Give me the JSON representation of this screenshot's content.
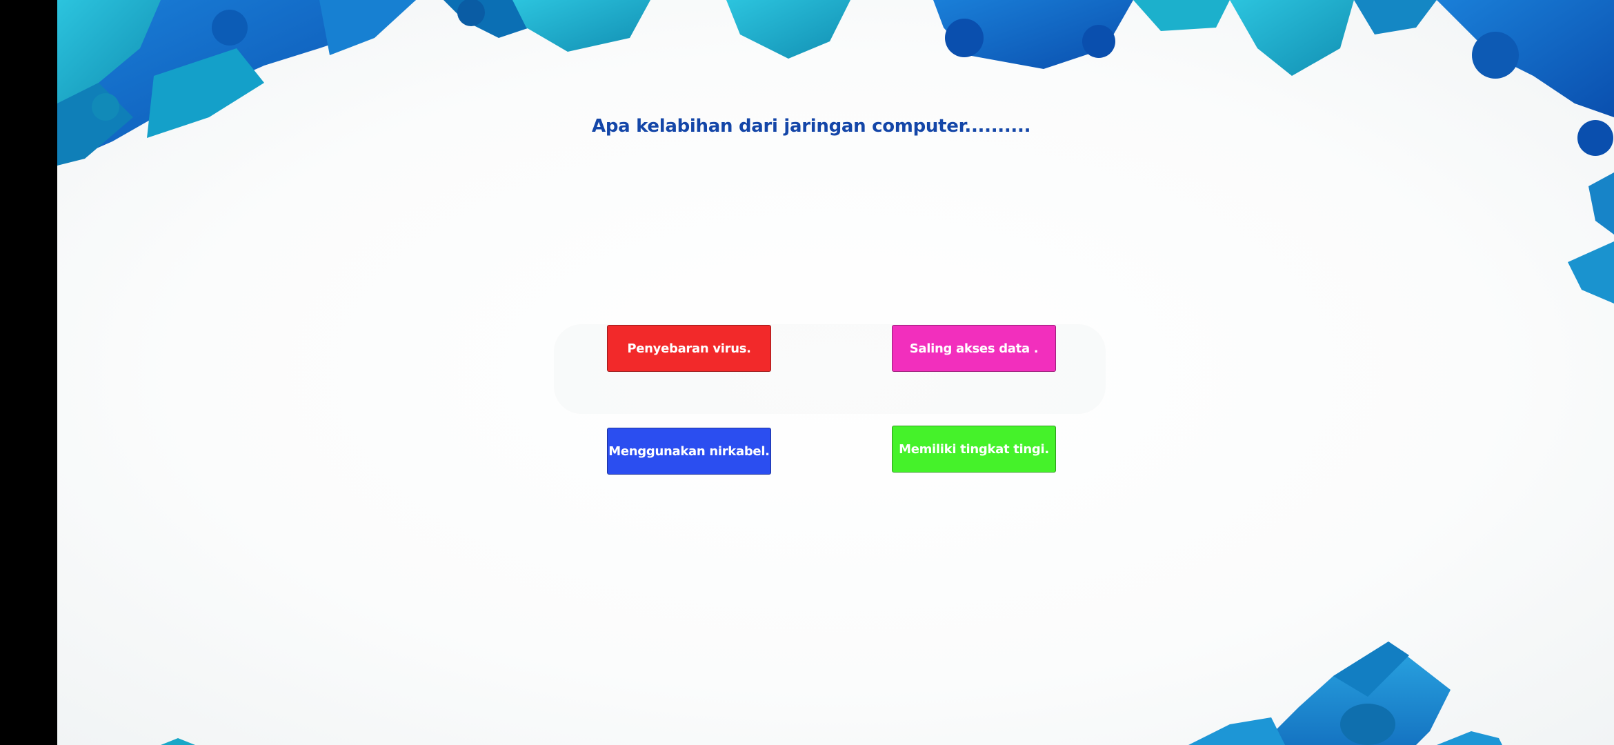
{
  "question": {
    "text": "Apa kelabihan dari jaringan computer.........."
  },
  "answers": [
    {
      "label": "Penyebaran virus.",
      "color": "#f2292a"
    },
    {
      "label": "Saling akses data .",
      "color": "#f22fbd"
    },
    {
      "label": "Menggunakan nirkabel.",
      "color": "#2b4ef0"
    },
    {
      "label": "Memiliki tingkat tingi.",
      "color": "#45f22a"
    }
  ],
  "theme": {
    "question_color": "#1446a8",
    "puzzle_dark": "#0b56b8",
    "puzzle_mid": "#1e8fd6",
    "puzzle_teal": "#19a7c7",
    "puzzle_light": "#2fc3e0"
  }
}
